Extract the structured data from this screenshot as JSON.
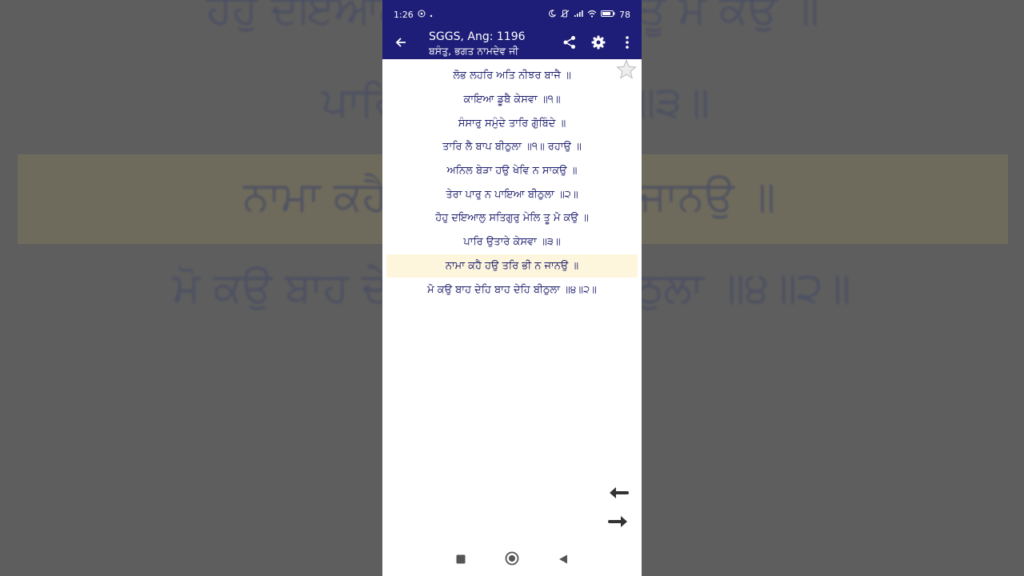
{
  "backdrop": {
    "lines": [
      "ਹੋਹੁ ਦਇਆਲੁ ਸਤਿਗੁਰੁ ਮੇਲਿ ਤੂ ਮੋ ਕਉ ॥",
      "ਪਾਰਿ ਉਤਾਰੇ ਕੇਸਵਾ ॥੩॥",
      "ਨਾਮਾ ਕਹੈ ਹਉ ਤਰਿ ਭੀ ਨ ਜਾਨਉ ॥",
      "ਮੋ ਕਉ ਬਾਹ ਦੇਹਿ ਬਾਹ ਦੇਹਿ ਬੀਠੁਲਾ ॥੪॥੨॥"
    ]
  },
  "status_bar": {
    "time": "1:26",
    "battery": "78",
    "icons": [
      "whatsapp-icon",
      "dot-icon",
      "moon-icon",
      "vibrate-off-icon",
      "signal-icon",
      "wifi-icon",
      "battery-icon"
    ]
  },
  "app_bar": {
    "title": "SGGS, Ang: 1196",
    "subtitle": "ਬਸੰਤੁ, ਭਗਤ ਨਾਮਦੇਵ ਜੀ",
    "color": "#1e1e78"
  },
  "verses": [
    "ਲੋਭ ਲਹਰਿ ਅਤਿ ਨੀਝਰ ਬਾਜੈ ॥",
    "ਕਾਇਆ ਡੂਬੈ ਕੇਸਵਾ ॥੧॥",
    "ਸੰਸਾਰੁ ਸਮੁੰਦੇ ਤਾਰਿ ਗੋੁਬਿੰਦੇ ॥",
    "ਤਾਰਿ ਲੈ ਬਾਪ ਬੀਠੁਲਾ ॥੧॥ ਰਹਾਉ ॥",
    "ਅਨਿਲ ਬੇੜਾ ਹਉ ਖੇਵਿ ਨ ਸਾਕਉ ॥",
    "ਤੇਰਾ ਪਾਰੁ ਨ ਪਾਇਆ ਬੀਠੁਲਾ ॥੨॥",
    "ਹੋਹੁ ਦਇਆਲੁ ਸਤਿਗੁਰੁ ਮੇਲਿ ਤੂ ਮੋ ਕਉ ॥",
    "ਪਾਰਿ ਉਤਾਰੇ ਕੇਸਵਾ ॥੩॥",
    "ਨਾਮਾ ਕਹੈ ਹਉ ਤਰਿ ਭੀ ਨ ਜਾਨਉ ॥",
    "ਮੋ ਕਉ ਬਾਹ ਦੇਹਿ ਬਾਹ ਦੇਹਿ ਬੀਠੁਲਾ ॥੪॥੨॥"
  ],
  "highlighted_verse_index": 8,
  "colors": {
    "verse_text": "#1b1b6b",
    "highlight": "#fdf6dc"
  }
}
